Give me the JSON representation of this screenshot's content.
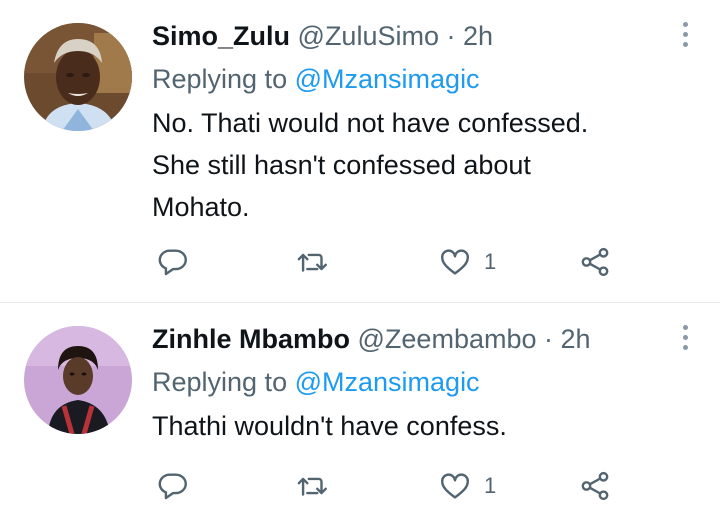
{
  "tweets": [
    {
      "display_name": "Simo_Zulu",
      "handle": "@ZuluSimo",
      "separator": "·",
      "time": "2h",
      "replying_prefix": "Replying to",
      "replying_to": "@Mzansimagic",
      "lines": [
        "No. Thati would not have confessed.",
        "She still hasn't confessed about",
        "Mohato."
      ],
      "like_count": "1",
      "avatar_icon": "avatar-photo-elderly-man"
    },
    {
      "display_name": "Zinhle Mbambo",
      "handle": "@Zeembambo",
      "separator": "·",
      "time": "2h",
      "replying_prefix": "Replying to",
      "replying_to": "@Mzansimagic",
      "lines": [
        "Thathi wouldn't have confess."
      ],
      "like_count": "1",
      "avatar_icon": "avatar-photo-young-woman"
    }
  ],
  "icons": {
    "reply": "reply-icon",
    "retweet": "retweet-icon",
    "like": "like-icon",
    "share": "share-icon",
    "more": "more-options-icon"
  },
  "colors": {
    "text": "#0f1419",
    "secondary": "#536471",
    "link": "#1d9bf0",
    "divider": "#e7e9ea"
  }
}
